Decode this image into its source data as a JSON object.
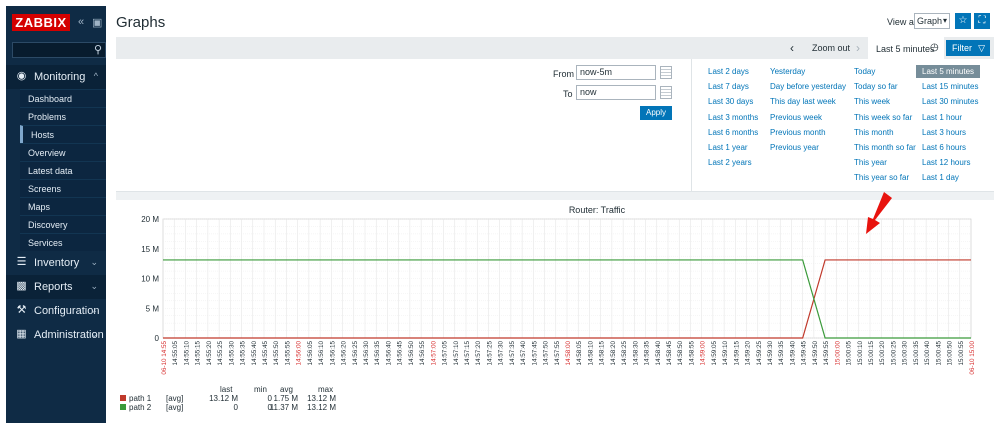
{
  "app": {
    "logo": "ZABBIX",
    "collapse_icon": "double-chevron-left-icon",
    "kiosk_icon": "expand-icon"
  },
  "sidebar": {
    "search_placeholder": "",
    "menu": [
      {
        "label": "Monitoring",
        "icon": "eye-icon",
        "open": true
      },
      {
        "label": "Inventory",
        "icon": "list-icon"
      },
      {
        "label": "Reports",
        "icon": "bar-chart-icon"
      },
      {
        "label": "Configuration",
        "icon": "wrench-icon"
      },
      {
        "label": "Administration",
        "icon": "gear-box-icon"
      }
    ],
    "submenu": [
      "Dashboard",
      "Problems",
      "Hosts",
      "Overview",
      "Latest data",
      "Screens",
      "Maps",
      "Discovery",
      "Services"
    ],
    "active_submenu": "Hosts"
  },
  "header": {
    "title": "Graphs",
    "view_as_label": "View as",
    "view_as_value": "Graph"
  },
  "filterbar": {
    "zoom_out": "Zoom out",
    "active_tab": "Last 5 minutes",
    "filter_label": "Filter"
  },
  "filter": {
    "from_label": "From",
    "from_value": "now-5m",
    "to_label": "To",
    "to_value": "now",
    "apply_label": "Apply",
    "ranges": [
      [
        "Last 2 days",
        "Last 7 days",
        "Last 30 days",
        "Last 3 months",
        "Last 6 months",
        "Last 1 year",
        "Last 2 years"
      ],
      [
        "Yesterday",
        "Day before yesterday",
        "This day last week",
        "Previous week",
        "Previous month",
        "Previous year"
      ],
      [
        "Today",
        "Today so far",
        "This week",
        "This week so far",
        "This month",
        "This month so far",
        "This year",
        "This year so far"
      ],
      [
        "Last 5 minutes",
        "Last 15 minutes",
        "Last 30 minutes",
        "Last 1 hour",
        "Last 3 hours",
        "Last 6 hours",
        "Last 12 hours",
        "Last 1 day"
      ]
    ],
    "selected_range": "Last 5 minutes"
  },
  "colors": {
    "path1": "#c0392b",
    "path2": "#3a9a3a",
    "accent": "#0275b8",
    "sidebar": "#0f2b45"
  },
  "chart_data": {
    "type": "line",
    "title": "Router: Traffic",
    "ylim": [
      0,
      20
    ],
    "y_ticks": [
      "0",
      "5 M",
      "10 M",
      "15 M",
      "20 M"
    ],
    "x_labels": [
      "06-10 14:55",
      "14:55:05",
      "14:55:10",
      "14:55:15",
      "14:55:20",
      "14:55:25",
      "14:55:30",
      "14:55:35",
      "14:55:40",
      "14:55:45",
      "14:55:50",
      "14:55:55",
      "14:56:00",
      "14:56:05",
      "14:56:10",
      "14:56:15",
      "14:56:20",
      "14:56:25",
      "14:56:30",
      "14:56:35",
      "14:56:40",
      "14:56:45",
      "14:56:50",
      "14:56:55",
      "14:57:00",
      "14:57:05",
      "14:57:10",
      "14:57:15",
      "14:57:20",
      "14:57:25",
      "14:57:30",
      "14:57:35",
      "14:57:40",
      "14:57:45",
      "14:57:50",
      "14:57:55",
      "14:58:00",
      "14:58:05",
      "14:58:10",
      "14:58:15",
      "14:58:20",
      "14:58:25",
      "14:58:30",
      "14:58:35",
      "14:58:40",
      "14:58:45",
      "14:58:50",
      "14:58:55",
      "14:59:00",
      "14:59:05",
      "14:59:10",
      "14:59:15",
      "14:59:20",
      "14:59:25",
      "14:59:30",
      "14:59:35",
      "14:59:40",
      "14:59:45",
      "14:59:50",
      "14:59:55",
      "15:00:00",
      "15:00:05",
      "15:00:10",
      "15:00:15",
      "15:00:20",
      "15:00:25",
      "15:00:30",
      "15:00:35",
      "15:00:40",
      "15:00:45",
      "15:00:50",
      "15:00:55",
      "06-10 15:00"
    ],
    "red_labels": [
      "06-10 14:55",
      "14:56:00",
      "14:57:00",
      "14:58:00",
      "14:59:00",
      "15:00:00",
      "06-10 15:00"
    ],
    "series": [
      {
        "name": "path 1",
        "color": "#c0392b",
        "x": [
          0,
          57,
          59,
          72
        ],
        "y": [
          0,
          0,
          13.12,
          13.12
        ]
      },
      {
        "name": "path 2",
        "color": "#3a9a3a",
        "x": [
          0,
          57,
          59,
          72
        ],
        "y": [
          13.12,
          13.12,
          0,
          0
        ]
      }
    ],
    "legend": {
      "headers": [
        "last",
        "min",
        "avg",
        "max"
      ],
      "rows": [
        {
          "name": "path 1",
          "func": "[avg]",
          "last": "13.12 M",
          "min": "0",
          "avg": "1.75 M",
          "max": "13.12 M"
        },
        {
          "name": "path 2",
          "func": "[avg]",
          "last": "0",
          "min": "0",
          "avg": "11.37 M",
          "max": "13.12 M"
        }
      ]
    }
  }
}
